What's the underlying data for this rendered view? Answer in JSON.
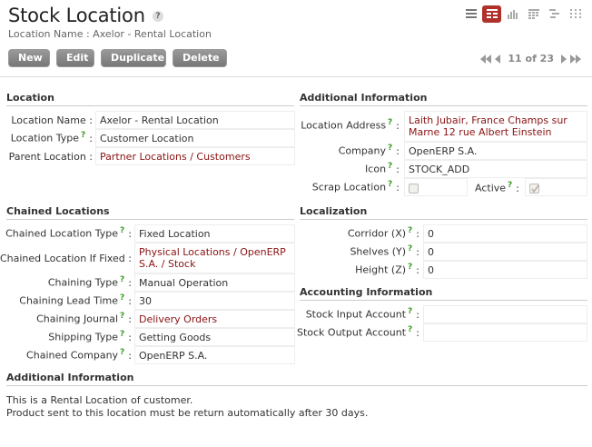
{
  "header": {
    "title": "Stock Location",
    "help": "?",
    "subtitle": "Location Name : Axelor - Rental Location"
  },
  "toolbar": {
    "new_label": "New",
    "edit_label": "Edit",
    "duplicate_label": "Duplicate",
    "delete_label": "Delete"
  },
  "pager": {
    "count": "11 of 23"
  },
  "location": {
    "title": "Location",
    "name_label": "Location Name :",
    "name_value": "Axelor - Rental Location",
    "type_label": "Location Type",
    "type_value": "Customer Location",
    "parent_label": "Parent Location :",
    "parent_value": "Partner Locations / Customers"
  },
  "additional": {
    "title": "Additional Information",
    "address_label": "Location Address",
    "address_value": "Laith Jubair, France Champs sur Marne 12 rue Albert Einstein",
    "company_label": "Company",
    "company_value": "OpenERP S.A.",
    "icon_label": "Icon",
    "icon_value": "STOCK_ADD",
    "scrap_label": "Scrap Location",
    "active_label": "Active"
  },
  "chained": {
    "title": "Chained Locations",
    "type_label": "Chained Location Type",
    "type_value": "Fixed Location",
    "fixed_label": "Chained Location If Fixed :",
    "fixed_value": "Physical Locations / OpenERP S.A. / Stock",
    "chaining_type_label": "Chaining Type",
    "chaining_type_value": "Manual Operation",
    "lead_time_label": "Chaining Lead Time",
    "lead_time_value": "30",
    "journal_label": "Chaining Journal",
    "journal_value": "Delivery Orders",
    "shipping_label": "Shipping Type",
    "shipping_value": "Getting Goods",
    "company_label": "Chained Company",
    "company_value": "OpenERP S.A."
  },
  "localization": {
    "title": "Localization",
    "corridor_label": "Corridor (X)",
    "corridor_value": "0",
    "shelves_label": "Shelves (Y)",
    "shelves_value": "0",
    "height_label": "Height (Z)",
    "height_value": "0"
  },
  "accounting": {
    "title": "Accounting Information",
    "input_label": "Stock Input Account",
    "input_value": "",
    "output_label": "Stock Output Account",
    "output_value": ""
  },
  "notes": {
    "title": "Additional Information",
    "line1": "This is a Rental Location of customer.",
    "line2": "Product sent to this location must be return automatically after 30 days."
  },
  "help_mark": "?"
}
